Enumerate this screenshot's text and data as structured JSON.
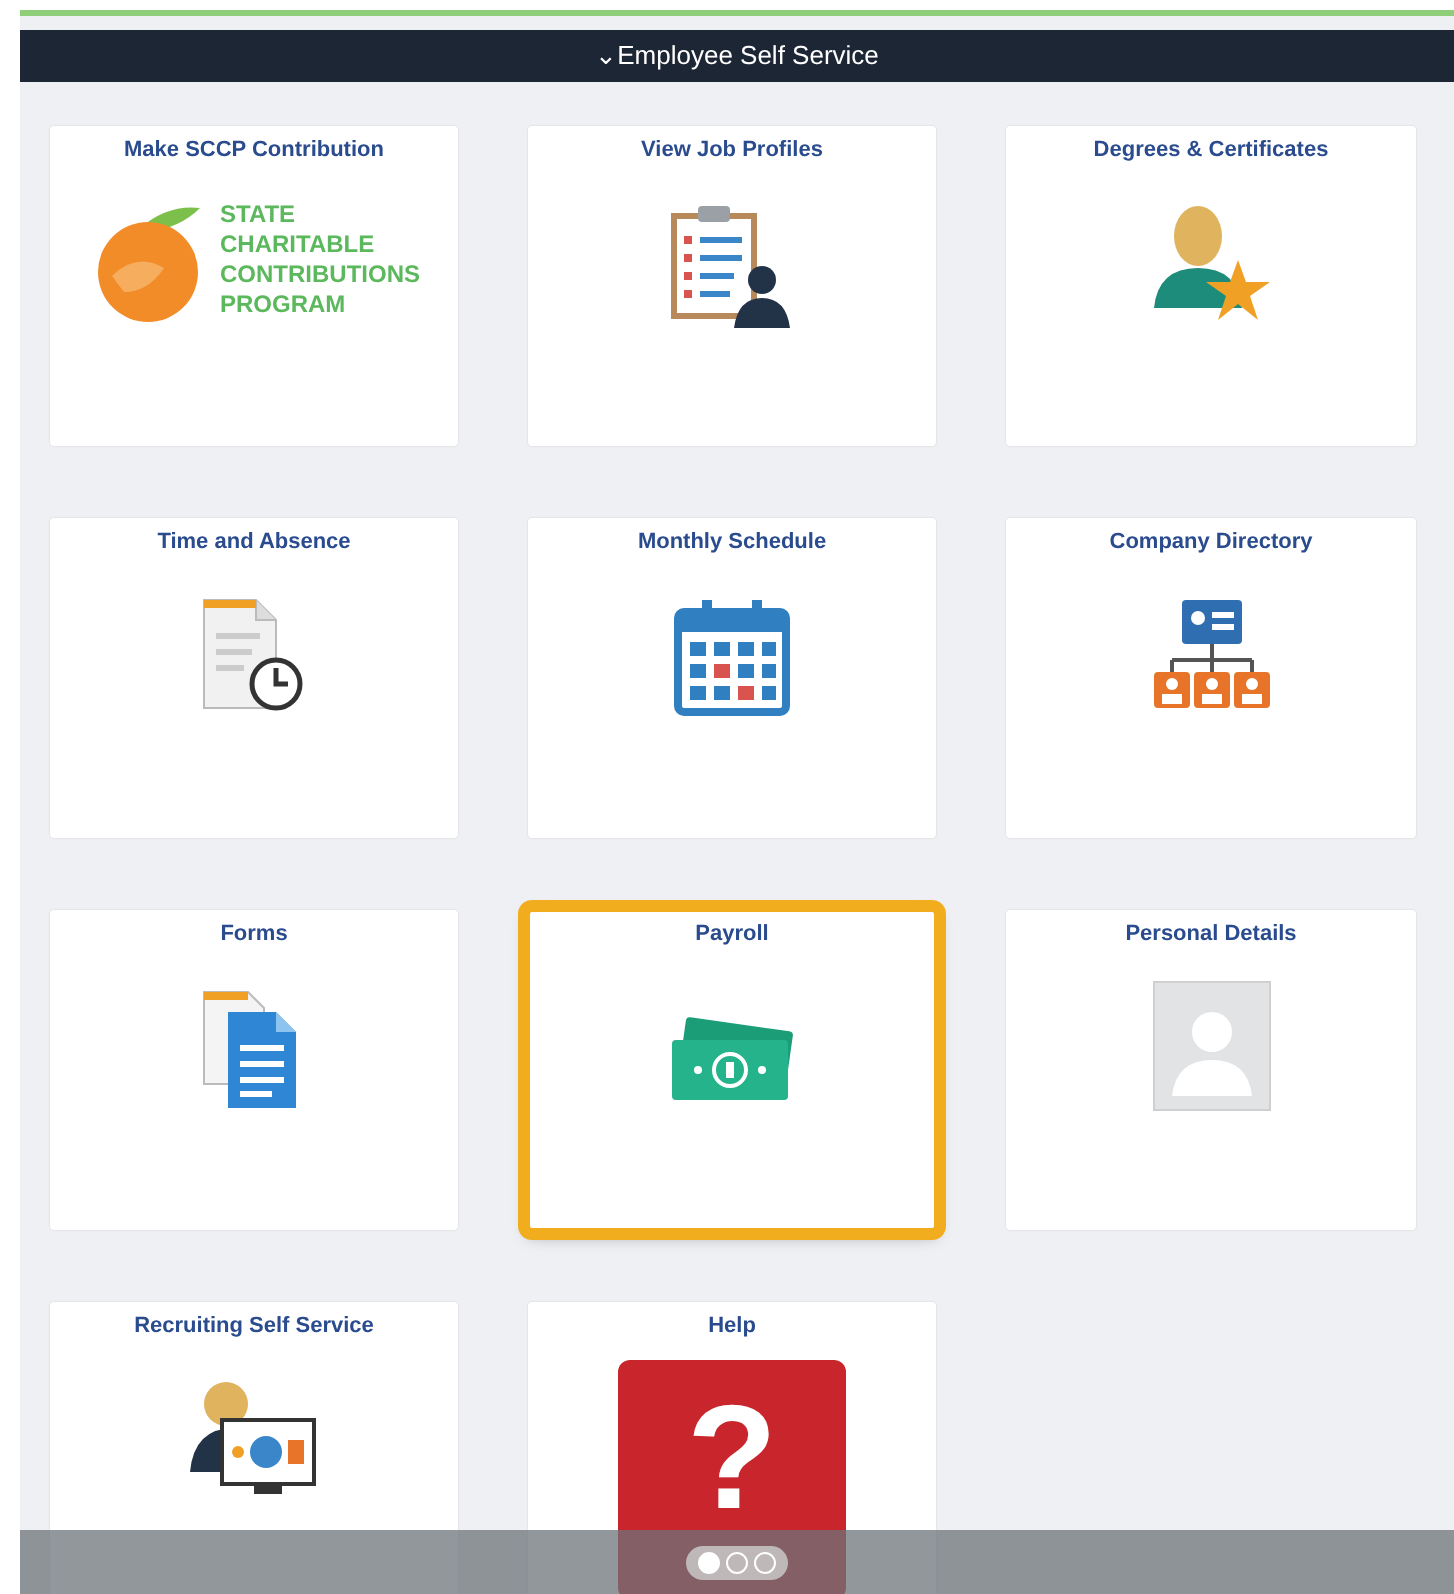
{
  "header": {
    "caret": "⌄",
    "title": "Employee Self Service"
  },
  "tiles": [
    {
      "title": "Make SCCP Contribution",
      "kind": "sccp",
      "logo_lines": [
        "STATE",
        "CHARITABLE",
        "CONTRIBUTIONS",
        "PROGRAM"
      ],
      "highlighted": false
    },
    {
      "title": "View Job Profiles",
      "kind": "job",
      "highlighted": false
    },
    {
      "title": "Degrees & Certificates",
      "kind": "degrees",
      "highlighted": false
    },
    {
      "title": "Time and Absence",
      "kind": "time",
      "highlighted": false
    },
    {
      "title": "Monthly Schedule",
      "kind": "schedule",
      "highlighted": false
    },
    {
      "title": "Company Directory",
      "kind": "directory",
      "highlighted": false
    },
    {
      "title": "Forms",
      "kind": "forms",
      "highlighted": false
    },
    {
      "title": "Payroll",
      "kind": "payroll",
      "highlighted": true
    },
    {
      "title": "Personal Details",
      "kind": "personal",
      "highlighted": false
    },
    {
      "title": "Recruiting Self Service",
      "kind": "recruiting",
      "highlighted": false
    },
    {
      "title": "Help",
      "kind": "help",
      "glyph": "?",
      "highlighted": false
    }
  ],
  "pager": [
    {
      "selected": true
    },
    {
      "selected": false
    },
    {
      "selected": false
    }
  ]
}
